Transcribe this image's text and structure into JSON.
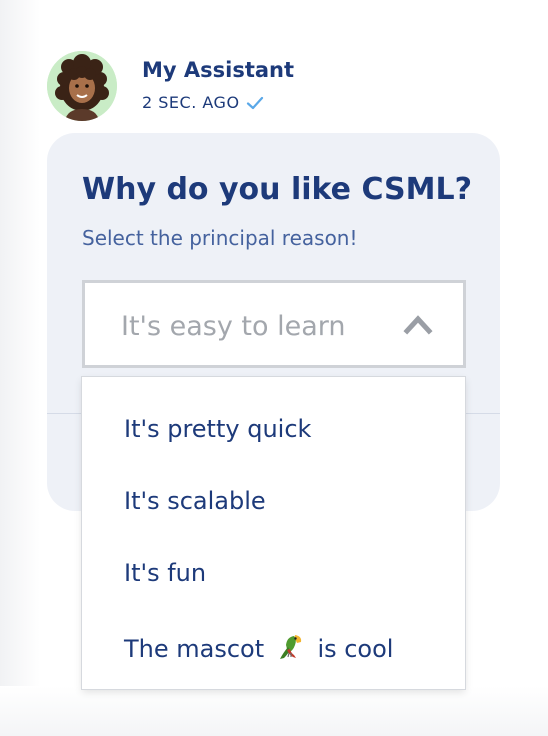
{
  "message": {
    "sender": "My Assistant",
    "timestamp": "2 SEC. AGO"
  },
  "question": {
    "title": "Why do you like CSML?",
    "subtitle": "Select the principal reason!"
  },
  "select": {
    "value": "It's easy to learn",
    "expanded": true,
    "options": [
      {
        "label": "It's pretty quick"
      },
      {
        "label": "It's scalable"
      },
      {
        "label": "It's fun"
      },
      {
        "label_before": "The mascot",
        "icon": "parrot-icon",
        "label_after": "is cool"
      }
    ]
  },
  "colors": {
    "primary_text": "#1d3a7a",
    "secondary_text": "#45629e",
    "card_background": "#eef1f7",
    "avatar_background": "#c9ecc6",
    "check_color": "#5aa8e8"
  }
}
